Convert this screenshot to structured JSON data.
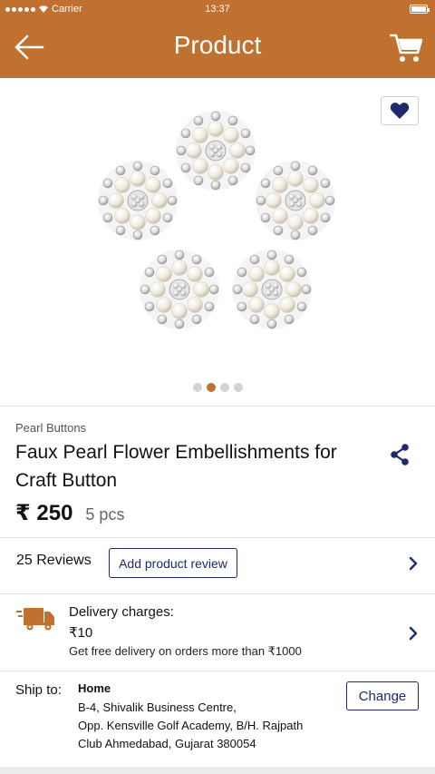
{
  "status_bar": {
    "carrier": "Carrier",
    "time": "13:37"
  },
  "header": {
    "title": "Product",
    "back_icon": "arrow-left-icon",
    "cart_icon": "cart-icon"
  },
  "gallery": {
    "image_name": "pearl-flower-buttons-image",
    "total_images": 4,
    "active_index": 1,
    "wishlist_icon": "heart-icon"
  },
  "product": {
    "category": "Pearl Buttons",
    "name": "Faux Pearl Flower Embellishments for Craft Button",
    "price": "₹ 250",
    "quantity": "5 pcs",
    "share_icon": "share-icon"
  },
  "reviews": {
    "count_label": "25 Reviews",
    "add_review_label": "Add product review"
  },
  "delivery": {
    "label": "Delivery charges:",
    "price": "₹10",
    "note": "Get free delivery on orders more than  ₹1000",
    "icon": "truck-icon"
  },
  "shipping": {
    "label": "Ship to:",
    "name": "Home",
    "address": " B-4, Shivalik Business Centre,\nOpp. Kensville Golf Academy, B/H. Rajpath\nClub Ahmedabad, Gujarat 380054",
    "change_label": "Change"
  },
  "colors": {
    "brand": "#c0702f",
    "navy": "#1d2a6e"
  }
}
